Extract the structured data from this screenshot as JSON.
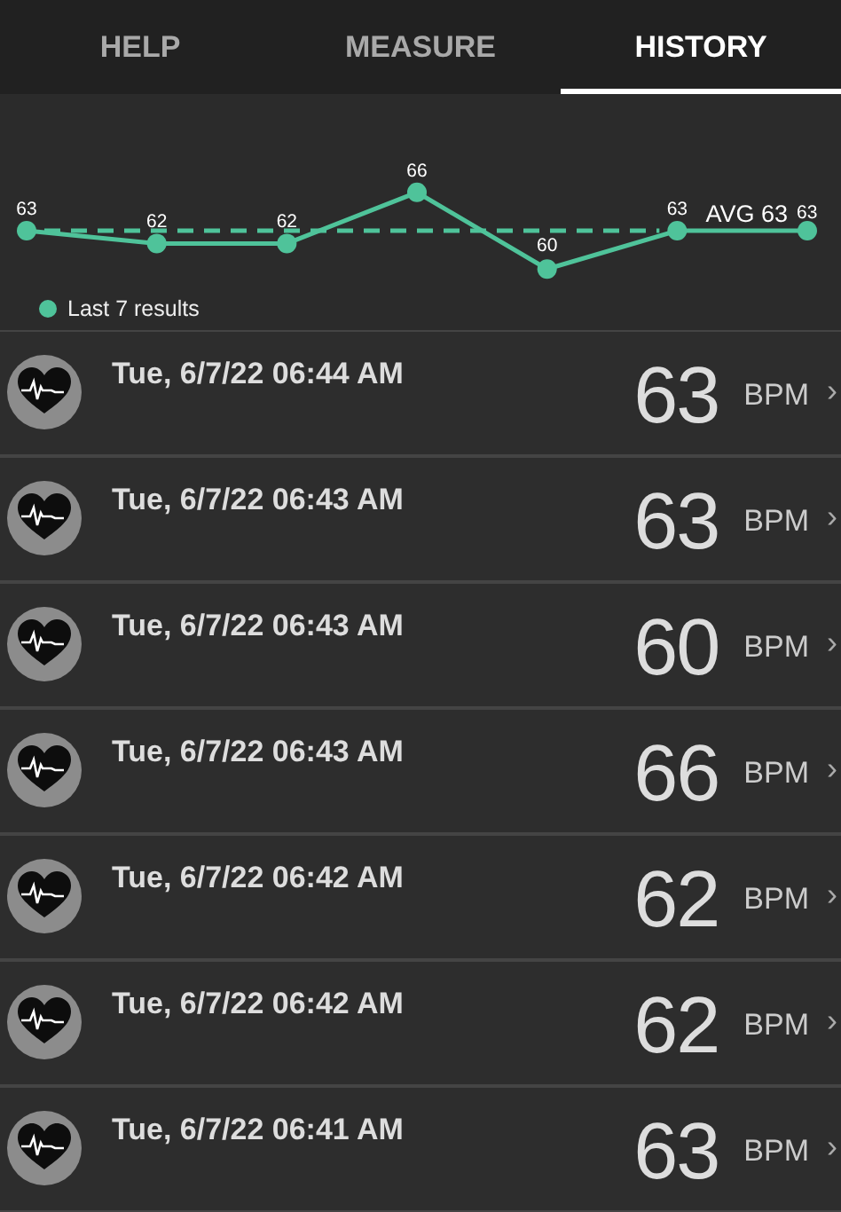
{
  "tabs": [
    {
      "label": "HELP",
      "selected": false
    },
    {
      "label": "MEASURE",
      "selected": false
    },
    {
      "label": "HISTORY",
      "selected": true
    }
  ],
  "chart": {
    "chart_data": {
      "type": "line",
      "data_labels": true,
      "series": [
        {
          "name": "Last 7 results",
          "color": "#4fc39a",
          "marker": "circle",
          "values": [
            63,
            62,
            62,
            66,
            60,
            63,
            63
          ]
        }
      ],
      "ref_lines": [
        {
          "label": "AVG 63"
        }
      ]
    }
  },
  "history": [
    {
      "date": "Tue, 6/7/22 06:44 AM",
      "bpm": "63",
      "unit": "BPM",
      "chevron": "›"
    },
    {
      "date": "Tue, 6/7/22 06:43 AM",
      "bpm": "63",
      "unit": "BPM",
      "chevron": "›"
    },
    {
      "date": "Tue, 6/7/22 06:43 AM",
      "bpm": "60",
      "unit": "BPM",
      "chevron": "›"
    },
    {
      "date": "Tue, 6/7/22 06:43 AM",
      "bpm": "66",
      "unit": "BPM",
      "chevron": "›"
    },
    {
      "date": "Tue, 6/7/22 06:42 AM",
      "bpm": "62",
      "unit": "BPM",
      "chevron": "›"
    },
    {
      "date": "Tue, 6/7/22 06:42 AM",
      "bpm": "62",
      "unit": "BPM",
      "chevron": "›"
    },
    {
      "date": "Tue, 6/7/22 06:41 AM",
      "bpm": "63",
      "unit": "BPM",
      "chevron": "›"
    }
  ]
}
